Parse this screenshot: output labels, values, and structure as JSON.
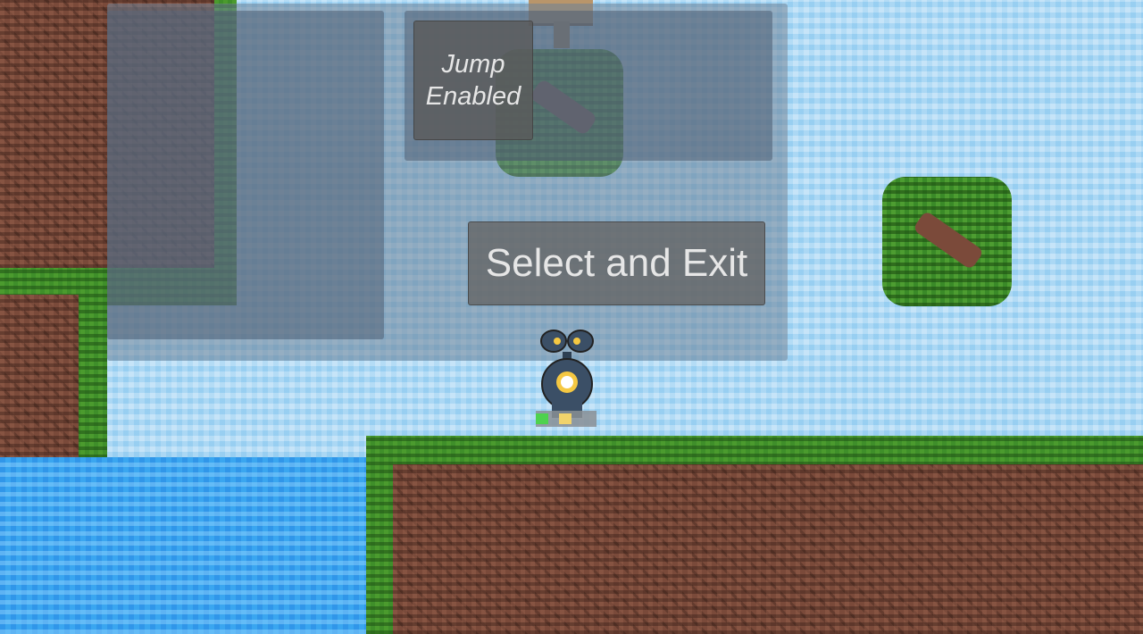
{
  "game": {
    "jump_toggle_label": "Jump\nEnabled",
    "select_exit_label": "Select and Exit"
  },
  "colors": {
    "panel": "#6e8296",
    "button": "#646464",
    "button_text": "#e6e6e6",
    "sky": "#a6d6f4",
    "water": "#3aa6f0",
    "grass": "#3f8f2a",
    "dirt": "#7a4a3a"
  },
  "icons": {
    "player": "robot-player-sprite",
    "bush": "bush-tile",
    "sign": "wooden-sign"
  }
}
